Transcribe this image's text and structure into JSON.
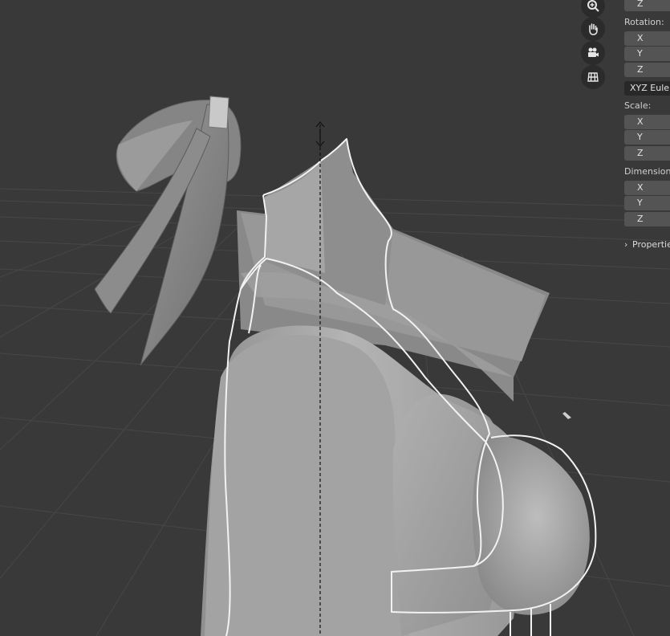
{
  "panel": {
    "location_z": "Z",
    "rotation_label": "Rotation:",
    "rotation": [
      "X",
      "Y",
      "Z"
    ],
    "rotation_mode": "XYZ Euler",
    "scale_label": "Scale:",
    "scale": [
      "X",
      "Y",
      "Z"
    ],
    "dimensions_label": "Dimensions",
    "dimensions": [
      "X",
      "Y",
      "Z"
    ],
    "properties_label": "Propertie"
  },
  "nav_icons": [
    "zoom-icon",
    "hand-pan-icon",
    "camera-icon",
    "grid-ortho-icon"
  ],
  "colors": {
    "background": "#393939",
    "grid": "#4a4a4a",
    "mesh": "#a8a8a8",
    "selection_outline": "#ffffff"
  }
}
